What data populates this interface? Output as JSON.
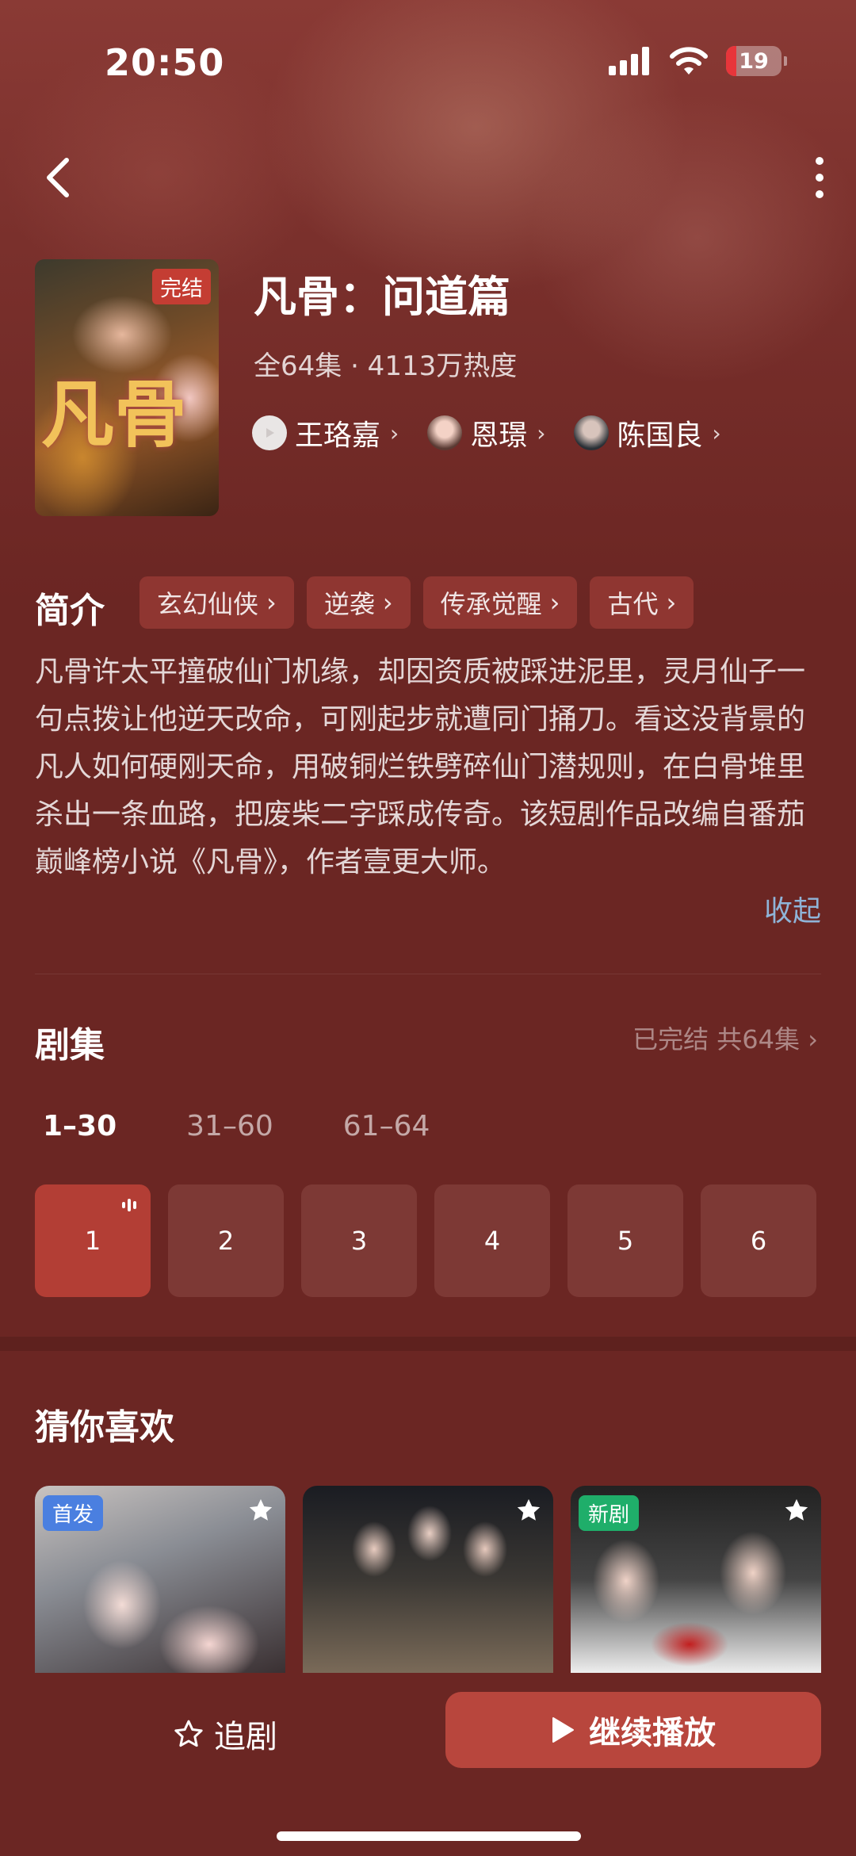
{
  "status_bar": {
    "time": "20:50",
    "battery": "19",
    "battery_level": 0.19
  },
  "drama": {
    "title": "凡骨：问道篇",
    "status_badge": "完结",
    "meta": "全64集 · 4113万热度",
    "poster_text": "凡骨",
    "cast": [
      {
        "name": "王珞嘉"
      },
      {
        "name": "恩璟"
      },
      {
        "name": "陈国良"
      }
    ]
  },
  "intro": {
    "label": "简介",
    "tags": [
      "玄幻仙侠",
      "逆袭",
      "传承觉醒",
      "古代"
    ],
    "text": "凡骨许太平撞破仙门机缘，却因资质被踩进泥里，灵月仙子一句点拨让他逆天改命，可刚起步就遭同门捅刀。看这没背景的凡人如何硬刚天命，用破铜烂铁劈碎仙门潜规则，在白骨堆里杀出一条血路，把废柴二字踩成传奇。该短剧作品改编自番茄巅峰榜小说《凡骨》，作者壹更大师。",
    "collapse": "收起"
  },
  "episodes": {
    "label": "剧集",
    "info": "已完结 共64集",
    "ranges": [
      "1–30",
      "31–60",
      "61–64"
    ],
    "items": [
      "1",
      "2",
      "3",
      "4",
      "5",
      "6"
    ]
  },
  "recommend": {
    "label": "猜你喜欢",
    "badges": [
      "首发",
      "",
      "新剧"
    ]
  },
  "actions": {
    "follow": "追剧",
    "play": "继续播放"
  },
  "colors": {
    "accent": "#b8463d",
    "background": "#6b2623",
    "link": "#8fb4d8"
  }
}
